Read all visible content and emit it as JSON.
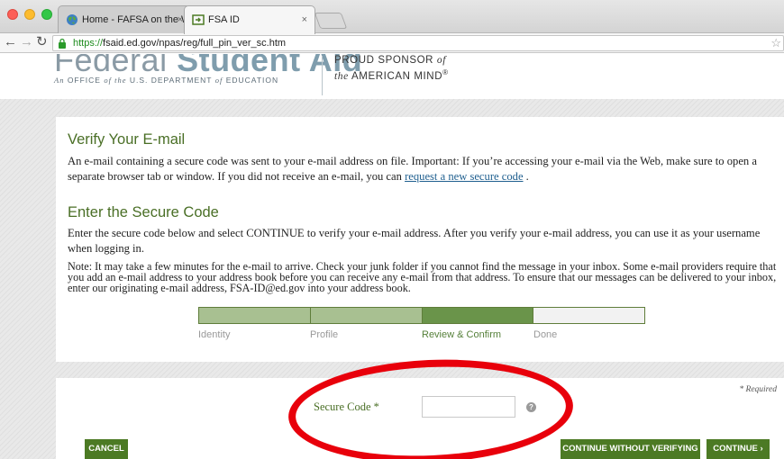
{
  "browser": {
    "tabs": [
      {
        "label": "Home - FAFSA on the Web",
        "active": false
      },
      {
        "label": "FSA ID",
        "active": true
      }
    ],
    "url_scheme": "https://",
    "url_rest": "fsaid.ed.gov/npas/reg/full_pin_ver_sc.htm",
    "icons": {
      "back": "back-arrow-icon",
      "forward": "forward-arrow-icon",
      "reload": "reload-icon",
      "lock": "lock-icon",
      "bookmark": "star-icon"
    }
  },
  "header": {
    "logo_part1": "Federal ",
    "logo_part2": "Student",
    "logo_part3": " Aid",
    "logo_sub_1": "An",
    "logo_sub_2": " OFFICE ",
    "logo_sub_3": "of the",
    "logo_sub_4": " U.S. DEPARTMENT ",
    "logo_sub_5": "of",
    "logo_sub_6": " EDUCATION",
    "sponsor_line1": "PROUD SPONSOR ",
    "sponsor_of": "of",
    "sponsor_the": "the",
    "sponsor_line2": " AMERICAN MIND",
    "sponsor_mark": "®"
  },
  "verify": {
    "title": "Verify Your E-mail",
    "text_before": "An e-mail containing a secure code was sent to your e-mail address on file. Important: If you’re accessing your e-mail via the Web, make sure to open a separate browser tab or window. If you did not receive an e-mail, you can ",
    "link": "request a new secure code",
    "text_after": " ."
  },
  "enter_code": {
    "title": "Enter the Secure Code",
    "text": "Enter the secure code below and select CONTINUE to verify your e-mail address. After you verify your e-mail address, you can use it as your username when logging in.",
    "note": "Note: It may take a few minutes for the e-mail to arrive. Check your junk folder if you cannot find the message in your inbox. Some e-mail providers require that you add an e-mail address to your address book before you can receive any e-mail from that address. To ensure that our messages can be delivered to your inbox, enter our originating e-mail address, FSA-ID@ed.gov into your address book."
  },
  "progress": {
    "steps": [
      {
        "label": "Identity",
        "status": "done"
      },
      {
        "label": "Profile",
        "status": "done"
      },
      {
        "label": "Review & Confirm",
        "status": "current"
      },
      {
        "label": "Done",
        "status": "todo"
      }
    ],
    "colors": {
      "done": "#a8c091",
      "current": "#6a944a",
      "todo": "#f2f2f2"
    }
  },
  "form": {
    "required_note": "* Required",
    "secure_code_label": "Secure Code *",
    "secure_code_value": "",
    "help_icon": "question-mark-icon",
    "help_glyph": "?"
  },
  "buttons": {
    "cancel": "CANCEL",
    "continue_without_verifying": "CONTINUE WITHOUT VERIFYING",
    "continue": "CONTINUE ›"
  },
  "colors": {
    "accent_green": "#4c7a24",
    "heading_green": "#4a6f26",
    "annotation_red": "#e8000b"
  }
}
